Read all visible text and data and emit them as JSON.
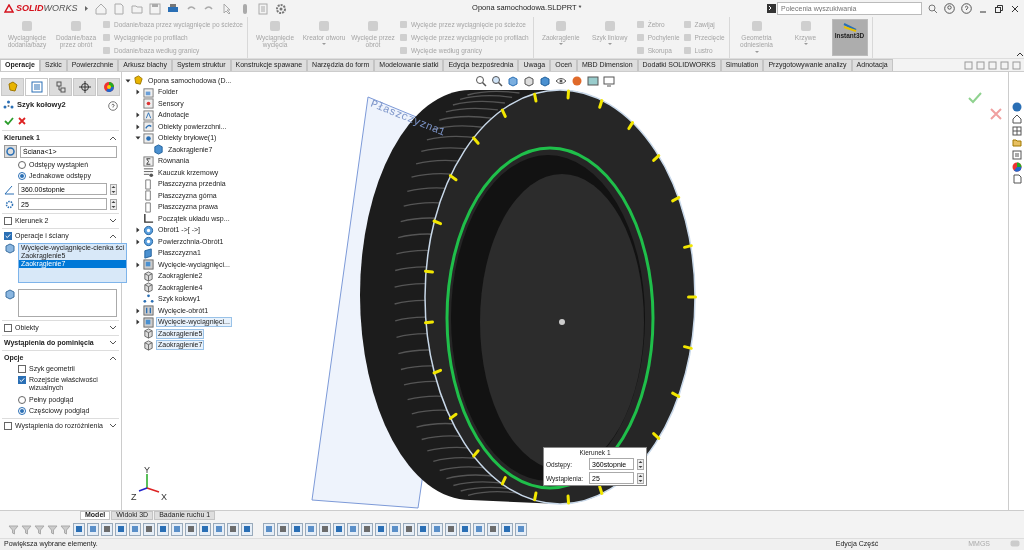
{
  "app": {
    "logo_bold": "SOLID",
    "logo_rest": "WORKS",
    "title": "Opona samochodowa.SLDPRT *",
    "search": {
      "placeholder": "Polecenia wyszukiwania"
    }
  },
  "ribbon": [
    {
      "items": [
        {
          "kind": "large",
          "label": "Wyciągnięcie dodania/bazy",
          "disabled": true
        },
        {
          "kind": "large",
          "label": "Dodanie/baza przez obrót",
          "disabled": true
        },
        {
          "kind": "stack",
          "entries": [
            {
              "label": "Dodanie/baza przez wyciągnięcie po ścieżce",
              "disabled": true
            },
            {
              "label": "Wyciągnięcie po profilach",
              "disabled": true
            },
            {
              "label": "Dodanie/baza według granicy",
              "disabled": true
            }
          ]
        }
      ]
    },
    {
      "items": [
        {
          "kind": "large",
          "label": "Wyciągnięcie wycięcia",
          "disabled": true
        },
        {
          "kind": "large",
          "label": "Kreator otworu",
          "disabled": true,
          "dropdown": true
        },
        {
          "kind": "large",
          "label": "Wycięcie przez obrót",
          "disabled": true
        },
        {
          "kind": "stack",
          "entries": [
            {
              "label": "Wycięcie przez wyciągnięcie po ścieżce",
              "disabled": true
            },
            {
              "label": "Wycięcie przez wyciągnięcie po profilach",
              "disabled": true
            },
            {
              "label": "Wycięcie według granicy",
              "disabled": true
            }
          ]
        }
      ]
    },
    {
      "items": [
        {
          "kind": "large",
          "label": "Zaokrąglenie",
          "disabled": true,
          "dropdown": true
        },
        {
          "kind": "large",
          "label": "Szyk liniowy",
          "disabled": true,
          "dropdown": true
        },
        {
          "kind": "stack",
          "entries": [
            {
              "label": "Żebro",
              "disabled": true
            },
            {
              "label": "Pochylenie",
              "disabled": true
            },
            {
              "label": "Skorupa",
              "disabled": true
            }
          ]
        },
        {
          "kind": "stack",
          "entries": [
            {
              "label": "Zawijaj",
              "disabled": true
            },
            {
              "label": "Przecięcie",
              "disabled": true
            },
            {
              "label": "Lustro",
              "disabled": true
            }
          ]
        }
      ]
    },
    {
      "items": [
        {
          "kind": "large",
          "label": "Geometria odniesienia",
          "disabled": true,
          "dropdown": true
        },
        {
          "kind": "large",
          "label": "Krzywe",
          "disabled": true,
          "dropdown": true
        },
        {
          "kind": "toggle",
          "label": "Instant3D",
          "on": true
        }
      ]
    }
  ],
  "tabs": [
    {
      "label": "Operacje",
      "selected": true
    },
    {
      "label": "Szkic",
      "selected": false
    },
    {
      "label": "Powierzchnie",
      "selected": false
    },
    {
      "label": "Arkusz blachy",
      "selected": false
    },
    {
      "label": "System struktur",
      "selected": false
    },
    {
      "label": "Konstrukcje spawane",
      "selected": false
    },
    {
      "label": "Narzędzia do form",
      "selected": false
    },
    {
      "label": "Modelowanie siatki",
      "selected": false
    },
    {
      "label": "Edycja bezpośrednia",
      "selected": false
    },
    {
      "label": "Uwaga",
      "selected": false
    },
    {
      "label": "Oceń",
      "selected": false
    },
    {
      "label": "MBD Dimension",
      "selected": false
    },
    {
      "label": "Dodatki SOLIDWORKS",
      "selected": false
    },
    {
      "label": "Simulation",
      "selected": false
    },
    {
      "label": "Przygotowywanie analizy",
      "selected": false
    },
    {
      "label": "Adnotacja",
      "selected": false
    }
  ],
  "property_manager": {
    "panel_tabs": [
      {
        "selected": false
      },
      {
        "selected": true
      },
      {
        "selected": false
      },
      {
        "selected": false
      },
      {
        "selected": false
      }
    ],
    "title": "Szyk kołowy2",
    "sections": [
      {
        "kind": "direction",
        "title": "Kierunek 1",
        "expanded": true,
        "reference": "Ściana<1>",
        "options": [
          {
            "label": "Odstępy wystąpień",
            "selected": false
          },
          {
            "label": "Jednakowe odstępy",
            "selected": true
          }
        ],
        "angle": "360.00stopnie",
        "count": "25"
      },
      {
        "kind": "header",
        "title": "Kierunek 2",
        "checked": false,
        "expanded": false
      },
      {
        "kind": "features",
        "title": "Operacje i ściany",
        "checked": true,
        "expanded": true,
        "features": [
          {
            "label": "Wycięcie-wyciągnięcie-cienka ści",
            "selected": false
          },
          {
            "label": "Zaokrąglenie5",
            "selected": false
          },
          {
            "label": "Zaokrąglenie7",
            "selected": true
          }
        ]
      },
      {
        "kind": "header",
        "title": "Obiekty",
        "checked": false,
        "expanded": false
      },
      {
        "kind": "header",
        "title": "Wystąpienia do pominięcia",
        "expanded": false
      },
      {
        "kind": "options",
        "title": "Opcje",
        "expanded": true,
        "checks": [
          {
            "label": "Szyk geometrii",
            "checked": false
          },
          {
            "label": "Rozejście właściwości wizualnych",
            "checked": true
          }
        ],
        "radios": [
          {
            "label": "Pełny podgląd",
            "selected": false
          },
          {
            "label": "Częściowy podgląd",
            "selected": true
          }
        ]
      },
      {
        "kind": "header",
        "title": "Wystąpienia do rozróżnienia",
        "checked": false,
        "expanded": false
      }
    ]
  },
  "tree": {
    "label": "Opona samochodowa (D...",
    "kind": "part",
    "expanded": true,
    "selected": false,
    "children": [
      {
        "label": "Folder",
        "kind": "folder",
        "expanded": false,
        "selected": false
      },
      {
        "label": "Sensory",
        "kind": "sensor",
        "selected": false
      },
      {
        "label": "Adnotacje",
        "kind": "annotation",
        "expanded": false,
        "selected": false
      },
      {
        "label": "Obiekty powierzchni...",
        "kind": "surface",
        "expanded": false,
        "selected": false
      },
      {
        "label": "Obiekty bryłowe(1)",
        "kind": "solid",
        "expanded": true,
        "selected": false,
        "children": [
          {
            "label": "Zaokrąglenie7",
            "kind": "body",
            "selected": false
          }
        ]
      },
      {
        "label": "Równania",
        "kind": "equation",
        "selected": false
      },
      {
        "label": "Kauczuk krzemowy",
        "kind": "material",
        "selected": false
      },
      {
        "label": "Płaszczyzna przednia",
        "kind": "plane",
        "selected": false
      },
      {
        "label": "Płaszczyzna górna",
        "kind": "plane",
        "selected": false
      },
      {
        "label": "Płaszczyzna prawa",
        "kind": "plane",
        "selected": false
      },
      {
        "label": "Początek układu wsp...",
        "kind": "origin",
        "selected": false
      },
      {
        "label": "Obrót1 ->[ ->]",
        "kind": "revolve",
        "expanded": false,
        "selected": false
      },
      {
        "label": "Powierzchnia-Obrót1",
        "kind": "revolve",
        "expanded": false,
        "selected": false
      },
      {
        "label": "Płaszczyzna1",
        "kind": "refplane",
        "selected": false
      },
      {
        "label": "Wycięcie-wyciągnięci...",
        "kind": "cut",
        "expanded": false,
        "selected": false
      },
      {
        "label": "Zaokrąglenie2",
        "kind": "fillet",
        "selected": false
      },
      {
        "label": "Zaokrąglenie4",
        "kind": "fillet",
        "selected": false
      },
      {
        "label": "Szyk kołowy1",
        "kind": "pattern",
        "selected": false
      },
      {
        "label": "Wycięcie-obrót1",
        "kind": "cutrevolve",
        "expanded": false,
        "selected": false
      },
      {
        "label": "Wycięcie-wyciągnięci...",
        "kind": "cut",
        "expanded": false,
        "selected": true
      },
      {
        "label": "Zaokrąglenie5",
        "kind": "fillet",
        "selected": true
      },
      {
        "label": "Zaokrąglenie7",
        "kind": "fillet",
        "selected": true
      }
    ]
  },
  "viewport": {
    "plane_label": "Płaszczyzna1",
    "callout": {
      "title": "Kierunek 1",
      "rows": [
        {
          "label": "Odstępy:",
          "value": "360stopnie"
        },
        {
          "label": "Wystąpienia:",
          "value": "25"
        }
      ]
    },
    "triad": [
      "Y",
      "X",
      "Z"
    ]
  },
  "model_tabs": [
    {
      "label": "Model",
      "selected": true
    },
    {
      "label": "Widoki 3D",
      "selected": false
    },
    {
      "label": "Badanie ruchu 1",
      "selected": false
    }
  ],
  "status_bar": {
    "message": "Powiększa wybrane elementy.",
    "mode": "Edycja Część",
    "units": "MMGS"
  }
}
